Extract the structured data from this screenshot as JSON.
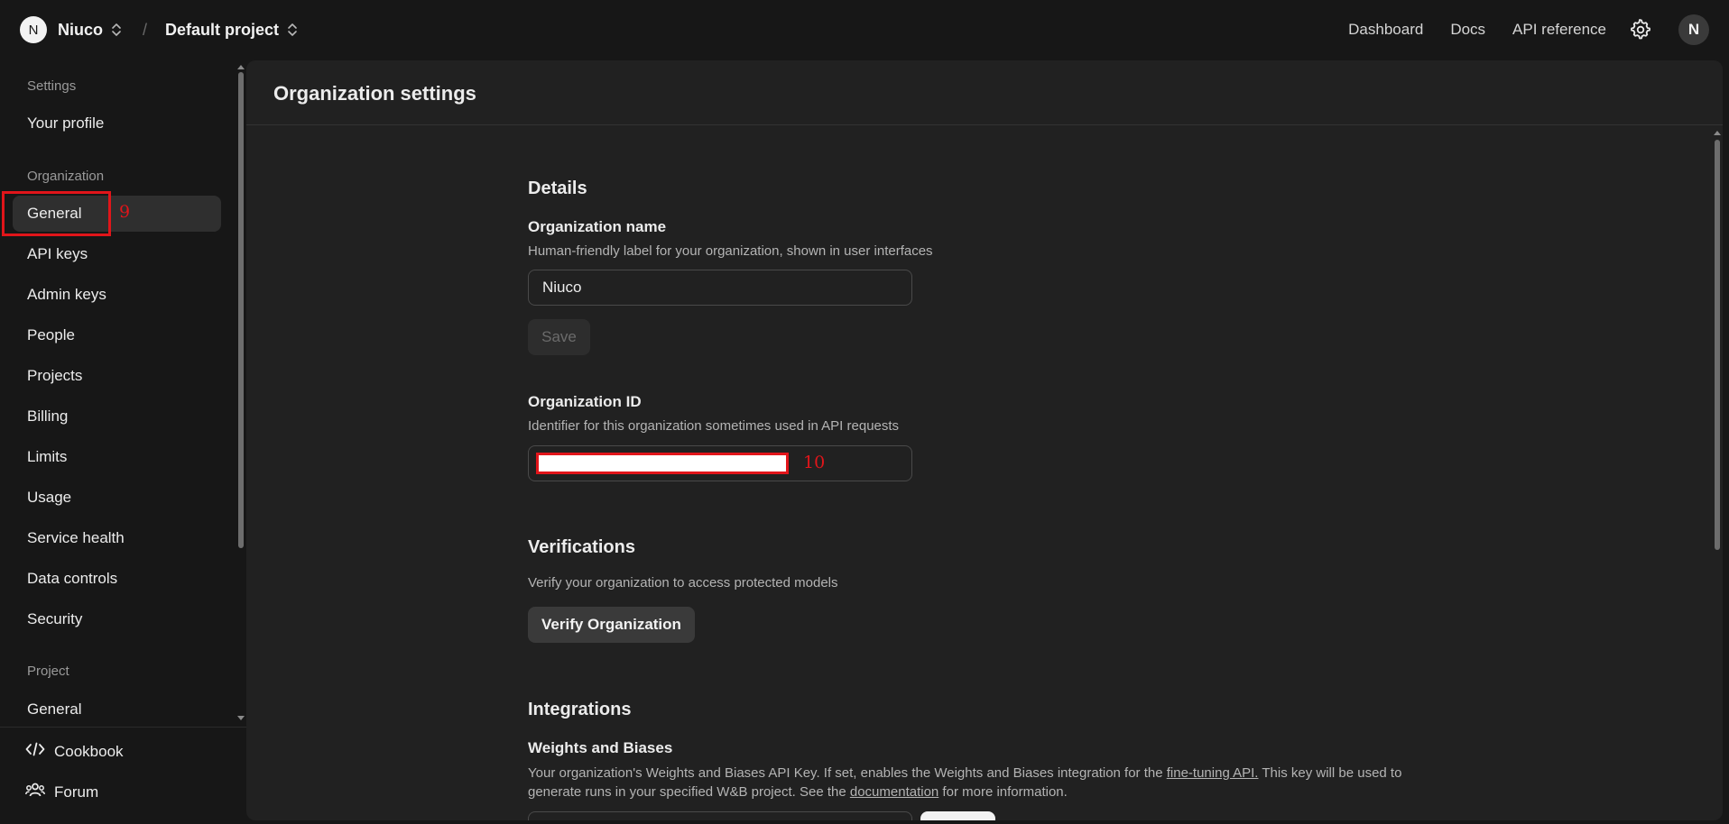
{
  "topbar": {
    "org_initial": "N",
    "org_name": "Niuco",
    "separator": "/",
    "project_name": "Default project",
    "links": [
      "Dashboard",
      "Docs",
      "API reference"
    ],
    "user_initial": "N"
  },
  "sidebar": {
    "settings_label": "Settings",
    "your_profile": "Your profile",
    "organization_label": "Organization",
    "org_items": [
      "General",
      "API keys",
      "Admin keys",
      "People",
      "Projects",
      "Billing",
      "Limits",
      "Usage",
      "Service health",
      "Data controls",
      "Security"
    ],
    "active_item": "General",
    "project_label": "Project",
    "project_items": [
      "General"
    ],
    "footer": {
      "cookbook": "Cookbook",
      "forum": "Forum"
    }
  },
  "annotations": {
    "general_marker": "9",
    "org_id_marker": "10"
  },
  "main": {
    "title": "Organization settings",
    "details": {
      "heading": "Details",
      "org_name_label": "Organization name",
      "org_name_desc": "Human-friendly label for your organization, shown in user interfaces",
      "org_name_value": "Niuco",
      "save_label": "Save",
      "org_id_label": "Organization ID",
      "org_id_desc": "Identifier for this organization sometimes used in API requests"
    },
    "verifications": {
      "heading": "Verifications",
      "desc": "Verify your organization to access protected models",
      "button": "Verify Organization"
    },
    "integrations": {
      "heading": "Integrations",
      "wb_label": "Weights and Biases",
      "wb_text_1": "Your organization's Weights and Biases API Key. If set, enables the Weights and Biases integration for the ",
      "wb_link_1": "fine-tuning API.",
      "wb_text_2": " This key will be used to generate runs in your specified W&B project. See the ",
      "wb_link_2": "documentation",
      "wb_text_3": " for more information."
    }
  },
  "colors": {
    "background": "#171717",
    "panel": "#212121",
    "active_nav": "#2f2f2f",
    "annotation_red": "#e1151a"
  }
}
